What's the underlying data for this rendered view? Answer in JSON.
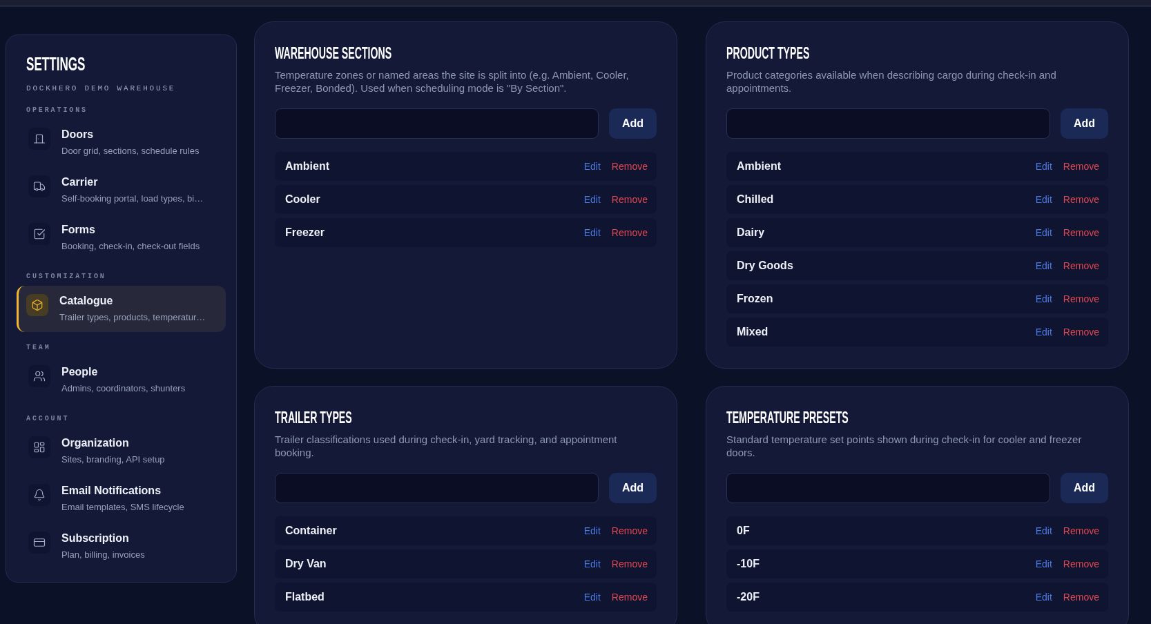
{
  "sidebar": {
    "title": "SETTINGS",
    "subtitle": "DOCKHERO DEMO WAREHOUSE",
    "groups": [
      {
        "label": "OPERATIONS",
        "items": [
          {
            "title": "Doors",
            "description": "Door grid, sections, schedule rules",
            "selected": false
          },
          {
            "title": "Carrier",
            "description": "Self-booking portal, load types, bi…",
            "selected": false
          },
          {
            "title": "Forms",
            "description": "Booking, check-in, check-out fields",
            "selected": false
          }
        ]
      },
      {
        "label": "CUSTOMIZATION",
        "items": [
          {
            "title": "Catalogue",
            "description": "Trailer types, products, temperatur…",
            "selected": true
          }
        ]
      },
      {
        "label": "TEAM",
        "items": [
          {
            "title": "People",
            "description": "Admins, coordinators, shunters",
            "selected": false
          }
        ]
      },
      {
        "label": "ACCOUNT",
        "items": [
          {
            "title": "Organization",
            "description": "Sites, branding, API setup",
            "selected": false
          },
          {
            "title": "Email Notifications",
            "description": "Email templates, SMS lifecycle",
            "selected": false
          },
          {
            "title": "Subscription",
            "description": "Plan, billing, invoices",
            "selected": false
          }
        ]
      }
    ]
  },
  "cards": [
    {
      "title": "WAREHOUSE SECTIONS",
      "description": "Temperature zones or named areas the site is split into (e.g. Ambient, Cooler, Freezer, Bonded). Used when scheduling mode is \"By Section\".",
      "add_button": "Add",
      "items": [
        {
          "name": "Ambient",
          "edit": "Edit",
          "remove": "Remove"
        },
        {
          "name": "Cooler",
          "edit": "Edit",
          "remove": "Remove"
        },
        {
          "name": "Freezer",
          "edit": "Edit",
          "remove": "Remove"
        }
      ]
    },
    {
      "title": "PRODUCT TYPES",
      "description": "Product categories available when describing cargo during check-in and appointments.",
      "add_button": "Add",
      "items": [
        {
          "name": "Ambient",
          "edit": "Edit",
          "remove": "Remove"
        },
        {
          "name": "Chilled",
          "edit": "Edit",
          "remove": "Remove"
        },
        {
          "name": "Dairy",
          "edit": "Edit",
          "remove": "Remove"
        },
        {
          "name": "Dry Goods",
          "edit": "Edit",
          "remove": "Remove"
        },
        {
          "name": "Frozen",
          "edit": "Edit",
          "remove": "Remove"
        },
        {
          "name": "Mixed",
          "edit": "Edit",
          "remove": "Remove"
        }
      ]
    },
    {
      "title": "TRAILER TYPES",
      "description": "Trailer classifications used during check-in, yard tracking, and appointment booking.",
      "add_button": "Add",
      "items": [
        {
          "name": "Container",
          "edit": "Edit",
          "remove": "Remove"
        },
        {
          "name": "Dry Van",
          "edit": "Edit",
          "remove": "Remove"
        },
        {
          "name": "Flatbed",
          "edit": "Edit",
          "remove": "Remove"
        }
      ]
    },
    {
      "title": "TEMPERATURE PRESETS",
      "description": "Standard temperature set points shown during check-in for cooler and freezer doors.",
      "add_button": "Add",
      "items": [
        {
          "name": "0F",
          "edit": "Edit",
          "remove": "Remove"
        },
        {
          "name": "-10F",
          "edit": "Edit",
          "remove": "Remove"
        },
        {
          "name": "-20F",
          "edit": "Edit",
          "remove": "Remove"
        }
      ]
    }
  ]
}
